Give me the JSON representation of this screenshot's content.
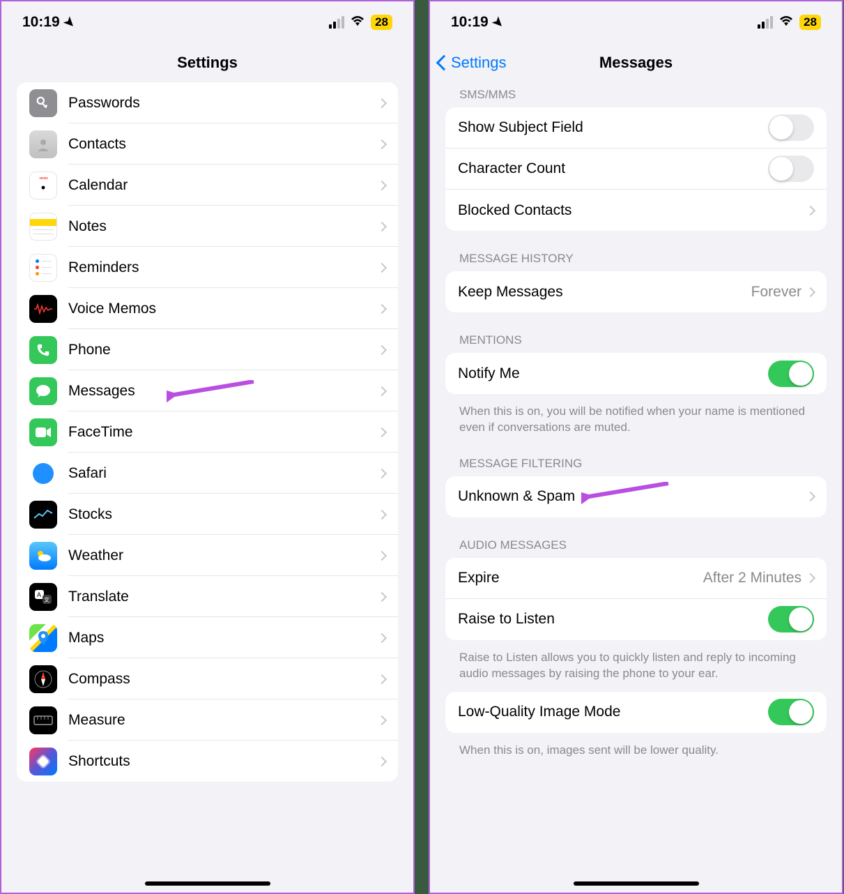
{
  "status": {
    "time": "10:19",
    "battery": "28"
  },
  "left": {
    "title": "Settings",
    "items": [
      {
        "id": "passwords",
        "label": "Passwords"
      },
      {
        "id": "contacts",
        "label": "Contacts"
      },
      {
        "id": "calendar",
        "label": "Calendar"
      },
      {
        "id": "notes",
        "label": "Notes"
      },
      {
        "id": "reminders",
        "label": "Reminders"
      },
      {
        "id": "voicememos",
        "label": "Voice Memos"
      },
      {
        "id": "phone",
        "label": "Phone"
      },
      {
        "id": "messages",
        "label": "Messages"
      },
      {
        "id": "facetime",
        "label": "FaceTime"
      },
      {
        "id": "safari",
        "label": "Safari"
      },
      {
        "id": "stocks",
        "label": "Stocks"
      },
      {
        "id": "weather",
        "label": "Weather"
      },
      {
        "id": "translate",
        "label": "Translate"
      },
      {
        "id": "maps",
        "label": "Maps"
      },
      {
        "id": "compass",
        "label": "Compass"
      },
      {
        "id": "measure",
        "label": "Measure"
      },
      {
        "id": "shortcuts",
        "label": "Shortcuts"
      }
    ]
  },
  "right": {
    "back": "Settings",
    "title": "Messages",
    "sections": {
      "sms": {
        "header": "SMS/MMS",
        "show_subject": "Show Subject Field",
        "char_count": "Character Count",
        "blocked": "Blocked Contacts"
      },
      "history": {
        "header": "MESSAGE HISTORY",
        "keep": "Keep Messages",
        "keep_value": "Forever"
      },
      "mentions": {
        "header": "MENTIONS",
        "notify": "Notify Me",
        "footer": "When this is on, you will be notified when your name is mentioned even if conversations are muted."
      },
      "filtering": {
        "header": "MESSAGE FILTERING",
        "unknown": "Unknown & Spam"
      },
      "audio": {
        "header": "AUDIO MESSAGES",
        "expire": "Expire",
        "expire_value": "After 2 Minutes",
        "raise": "Raise to Listen",
        "footer": "Raise to Listen allows you to quickly listen and reply to incoming audio messages by raising the phone to your ear."
      },
      "lowq": {
        "label": "Low-Quality Image Mode",
        "footer": "When this is on, images sent will be lower quality."
      }
    }
  }
}
